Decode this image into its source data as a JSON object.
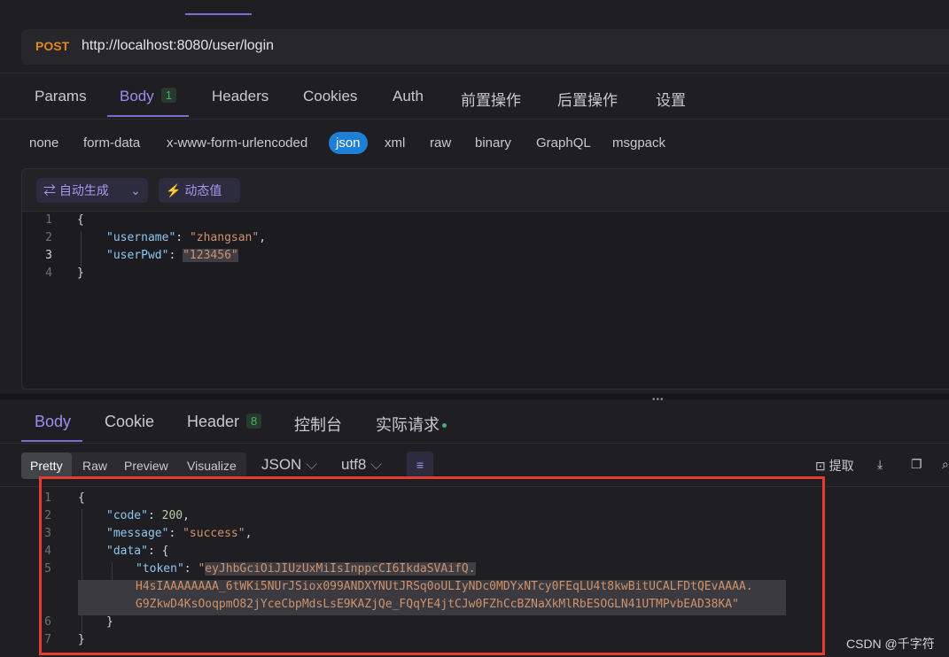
{
  "request": {
    "method": "POST",
    "url": "http://localhost:8080/user/login",
    "tabs": [
      {
        "label": "Params"
      },
      {
        "label": "Body",
        "badge": "1"
      },
      {
        "label": "Headers"
      },
      {
        "label": "Cookies"
      },
      {
        "label": "Auth"
      },
      {
        "label": "前置操作"
      },
      {
        "label": "后置操作"
      },
      {
        "label": "设置"
      }
    ],
    "active_tab": "Body",
    "body_types": [
      "none",
      "form-data",
      "x-www-form-urlencoded",
      "json",
      "xml",
      "raw",
      "binary",
      "GraphQL",
      "msgpack"
    ],
    "active_body_type": "json",
    "toolbar": {
      "auto_generate": "自动生成",
      "dynamic_value": "动态值"
    },
    "body_lines": {
      "n1": "1",
      "n2": "2",
      "n3": "3",
      "n4": "4",
      "open": "{",
      "k1": "\"username\"",
      "v1": "\"zhangsan\"",
      "k2": "\"userPwd\"",
      "v2": "\"123456\"",
      "close": "}"
    }
  },
  "response": {
    "tabs": [
      {
        "label": "Body"
      },
      {
        "label": "Cookie"
      },
      {
        "label": "Header",
        "badge": "8"
      },
      {
        "label": "控制台"
      },
      {
        "label": "实际请求"
      }
    ],
    "active_tab": "Body",
    "view_modes": [
      "Pretty",
      "Raw",
      "Preview",
      "Visualize"
    ],
    "active_view": "Pretty",
    "format": "JSON",
    "encoding": "utf8",
    "extract_label": "提取",
    "lines": {
      "n1": "1",
      "n2": "2",
      "n3": "3",
      "n4": "4",
      "n5": "5",
      "n6": "6",
      "n7": "7",
      "open": "{",
      "code_key": "\"code\"",
      "code_val": "200",
      "msg_key": "\"message\"",
      "msg_val": "\"success\"",
      "data_key": "\"data\"",
      "data_open": "{",
      "token_key": "\"token\"",
      "token_l1": "eyJhbGciOiJIUzUxMiIsInppcCI6IkdaSVAifQ.",
      "token_l2": "H4sIAAAAAAAA_6tWKi5NUrJSiox099ANDXYNUtJRSq0oULIyNDc0MDYxNTcy0FEqLU4t8kwBitUCALFDtQEvAAAA.",
      "token_l3": "G9ZkwD4KsOoqpmO82jYceCbpMdsLsE9KAZjQe_FQqYE4jtCJw0FZhCcBZNaXkMlRbESOGLN41UTMPvbEAD38KA",
      "data_close": "}",
      "close": "}"
    }
  },
  "watermark": "CSDN @千字符",
  "colors": {
    "accent": "#7c6cd6",
    "method": "#e3861c",
    "json_active": "#1e7fd6",
    "highlight_box": "#e53b30"
  }
}
